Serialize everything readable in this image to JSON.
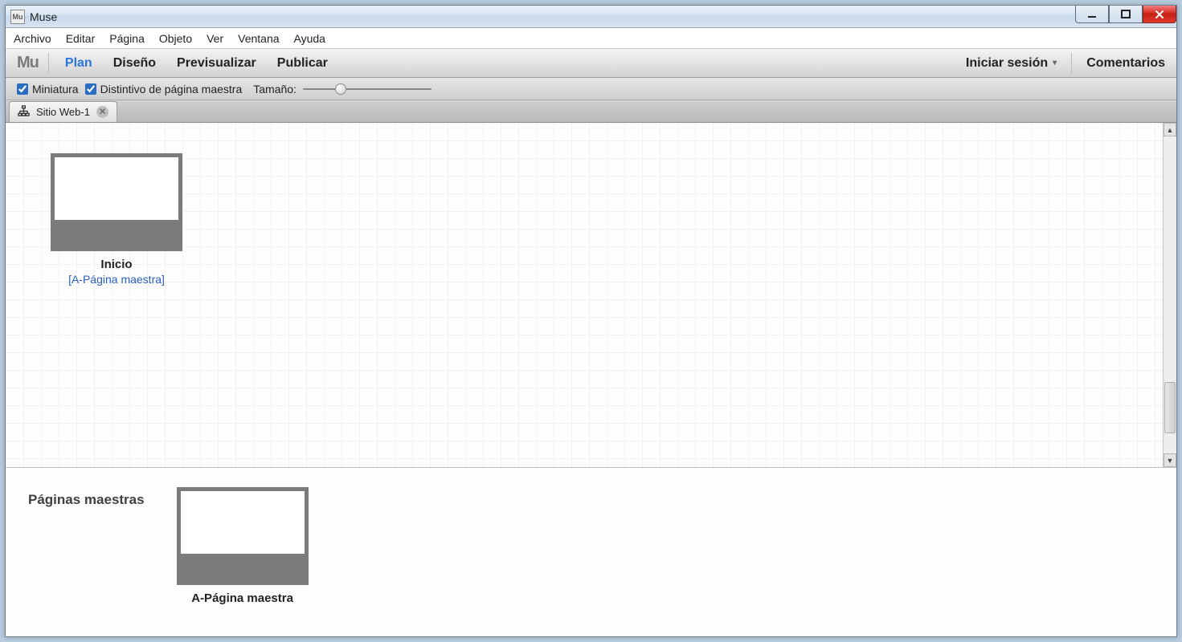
{
  "window": {
    "title": "Muse",
    "icon_label": "Mu"
  },
  "menubar": [
    "Archivo",
    "Editar",
    "Página",
    "Objeto",
    "Ver",
    "Ventana",
    "Ayuda"
  ],
  "modes": {
    "logo": "Mu",
    "items": [
      "Plan",
      "Diseño",
      "Previsualizar",
      "Publicar"
    ],
    "active_index": 0
  },
  "right": {
    "signin": "Iniciar sesión",
    "comments": "Comentarios"
  },
  "options": {
    "thumb_checkbox": "Miniatura",
    "master_badge_checkbox": "Distintivo de página maestra",
    "size_label": "Tamaño:"
  },
  "tab": {
    "label": "Sitio Web-1"
  },
  "sitemap": {
    "page": {
      "name": "Inicio",
      "master": "[A-Página maestra]"
    }
  },
  "masters_panel": {
    "heading": "Páginas maestras",
    "master": {
      "name": "A-Página maestra"
    }
  }
}
